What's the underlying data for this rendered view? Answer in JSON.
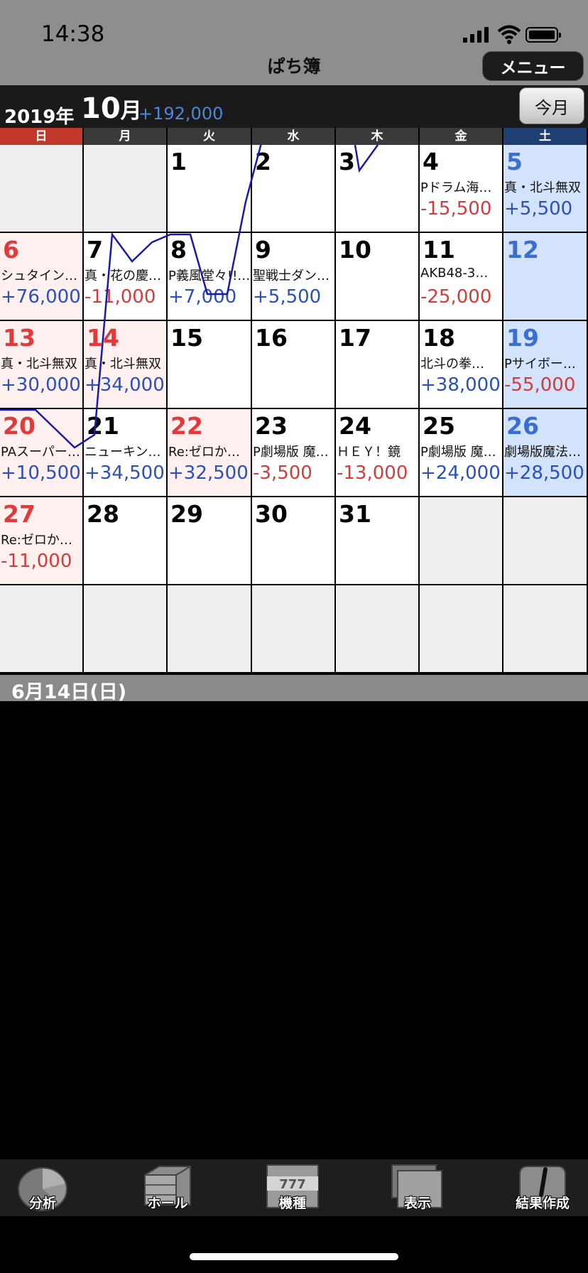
{
  "status": {
    "time": "14:38"
  },
  "app": {
    "title": "ぱち簿",
    "menu_label": "メニュー",
    "today_label": "今月"
  },
  "month": {
    "year": "2019年",
    "month": "10",
    "month_suffix": "月",
    "total": "+192,000"
  },
  "weekdays": [
    "日",
    "月",
    "火",
    "水",
    "木",
    "金",
    "土"
  ],
  "colors": {
    "sunday": "#c0392b",
    "saturday": "#1f3f73",
    "weekday": "#3a3a3a",
    "positive": "#2c4fbf",
    "negative": "#d33c3c",
    "sun_day": "#e23a3a",
    "sat_day": "#3a6fd0",
    "sun_bg": "#fff0f0",
    "sat_bg": "#d3e3fb",
    "empty_bg": "#efefef",
    "graph": "#1a1aaa"
  },
  "calendar": [
    [
      null,
      null,
      {
        "day": "1"
      },
      {
        "day": "2"
      },
      {
        "day": "3"
      },
      {
        "day": "4",
        "machine": "Pドラム海…",
        "result": "-15,500"
      },
      {
        "day": "5",
        "machine": "真・北斗無双",
        "result": "+5,500"
      }
    ],
    [
      {
        "day": "6",
        "machine": "シュタイン…",
        "result": "+76,000"
      },
      {
        "day": "7",
        "machine": "真・花の慶…",
        "result": "-11,000"
      },
      {
        "day": "8",
        "machine": "P義風堂々!!…",
        "result": "+7,000"
      },
      {
        "day": "9",
        "machine": "聖戦士ダン…",
        "result": "+5,500"
      },
      {
        "day": "10"
      },
      {
        "day": "11",
        "machine": " AKB48-3…",
        "result": "-25,000"
      },
      {
        "day": "12"
      }
    ],
    [
      {
        "day": "13",
        "machine": "真・北斗無双",
        "result": "+30,000"
      },
      {
        "day": "14",
        "machine": "真・北斗無双",
        "result": "+34,000"
      },
      {
        "day": "15"
      },
      {
        "day": "16"
      },
      {
        "day": "17"
      },
      {
        "day": "18",
        "machine": "北斗の拳…",
        "result": "+38,000"
      },
      {
        "day": "19",
        "machine": "Pサイボー…",
        "result": "-55,000"
      }
    ],
    [
      {
        "day": "20",
        "machine": "PAスーパー…",
        "result": "+10,500"
      },
      {
        "day": "21",
        "machine": "ニューキン…",
        "result": "+34,500"
      },
      {
        "day": "22",
        "machine": "Re:ゼロか…",
        "result": "+32,500"
      },
      {
        "day": "23",
        "machine": "P劇場版 魔…",
        "result": "-3,500"
      },
      {
        "day": "24",
        "machine": "ＨＥＹ！鏡",
        "result": "-13,000"
      },
      {
        "day": "25",
        "machine": "P劇場版 魔…",
        "result": "+24,000"
      },
      {
        "day": "26",
        "machine": "劇場版魔法…",
        "result": "+28,500"
      }
    ],
    [
      {
        "day": "27",
        "machine": "Re:ゼロか…",
        "result": "-11,000"
      },
      {
        "day": "28"
      },
      {
        "day": "29"
      },
      {
        "day": "30"
      },
      {
        "day": "31"
      },
      null,
      null
    ],
    [
      null,
      null,
      null,
      null,
      null,
      null,
      null
    ]
  ],
  "selected_date": "6月14日(日)",
  "tabs": [
    {
      "label": "分析",
      "icon": "pie-chart-icon"
    },
    {
      "label": "ホール",
      "icon": "building-icon"
    },
    {
      "label": "機種",
      "icon": "slot-machine-icon"
    },
    {
      "label": "表示",
      "icon": "display-icon"
    },
    {
      "label": "結果作成",
      "icon": "pencil-icon"
    }
  ]
}
